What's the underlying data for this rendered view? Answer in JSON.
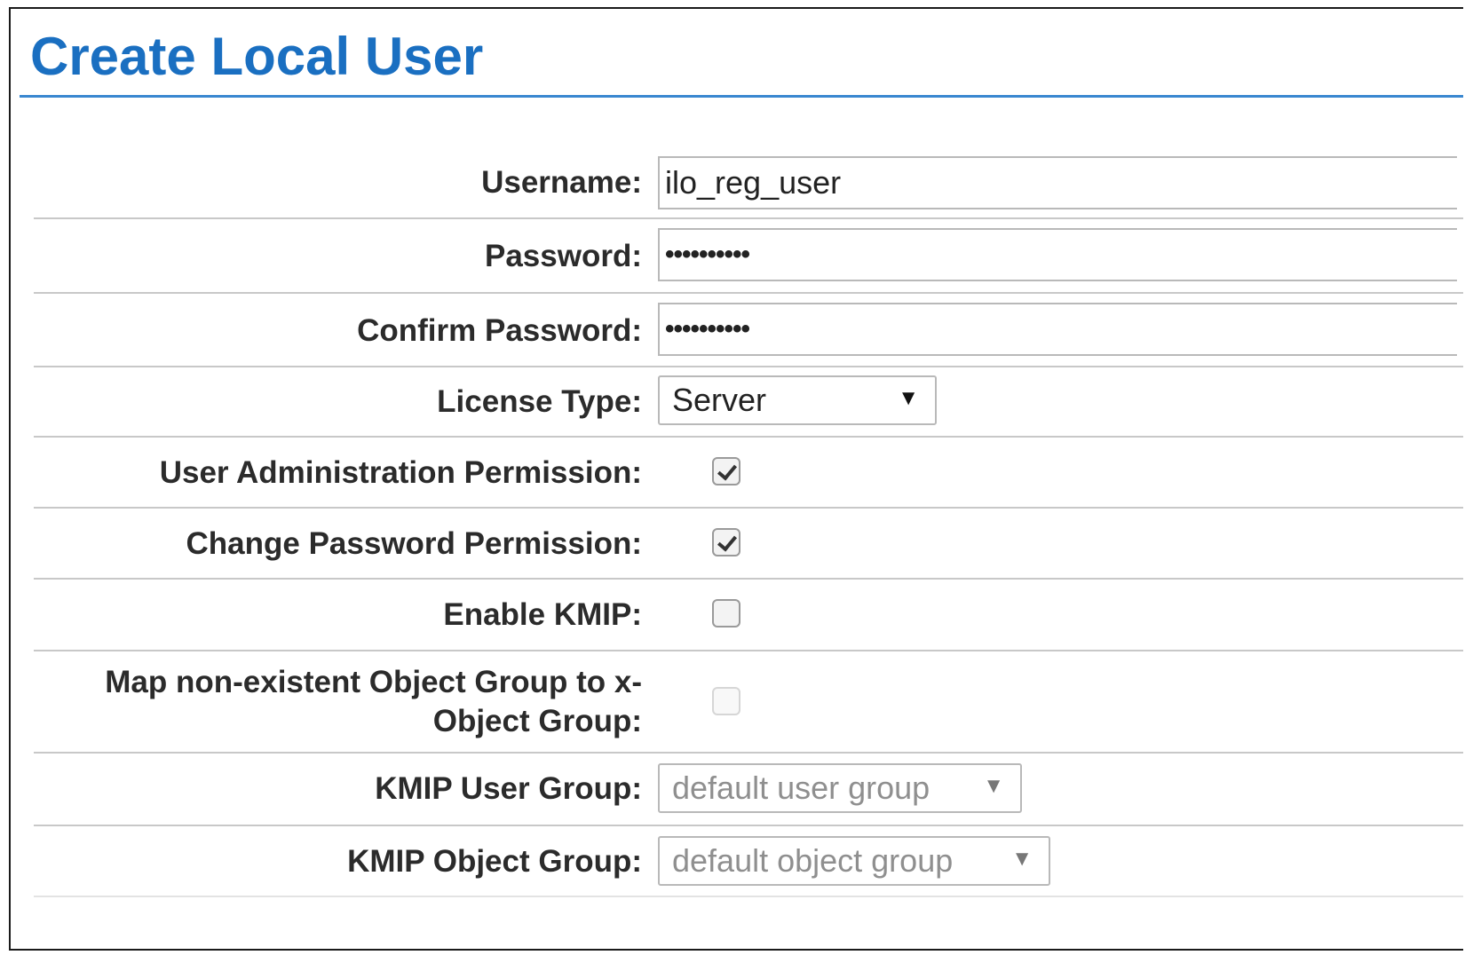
{
  "page": {
    "title": "Create Local User"
  },
  "form": {
    "username": {
      "label": "Username:",
      "value": "ilo_reg_user"
    },
    "password": {
      "label": "Password:",
      "masked_value": "••••••••••"
    },
    "confirm_password": {
      "label": "Confirm Password:",
      "masked_value": "••••••••••"
    },
    "license_type": {
      "label": "License Type:",
      "selected": "Server",
      "arrow": "▼"
    },
    "user_admin_permission": {
      "label": "User Administration Permission:",
      "checked": true
    },
    "change_password_permission": {
      "label": "Change Password Permission:",
      "checked": true
    },
    "enable_kmip": {
      "label": "Enable KMIP:",
      "checked": false
    },
    "map_nonexistent_group": {
      "label_line1": "Map non-existent Object Group to x-",
      "label_line2": "Object Group:",
      "checked": false,
      "disabled": true
    },
    "kmip_user_group": {
      "label": "KMIP User Group:",
      "selected": "default user group",
      "arrow": "▼",
      "disabled": true
    },
    "kmip_object_group": {
      "label": "KMIP Object Group:",
      "selected": "default object group",
      "arrow": "▼",
      "disabled": true
    }
  },
  "colors": {
    "title": "#1a6fc1",
    "title_rule": "#3a87d0",
    "row_divider": "#c8c8c8",
    "label_text": "#2b2b2b",
    "disabled_text": "#8f8f8f"
  },
  "icons": {
    "dropdown": "chevron-down-icon",
    "check": "checkmark-icon"
  }
}
